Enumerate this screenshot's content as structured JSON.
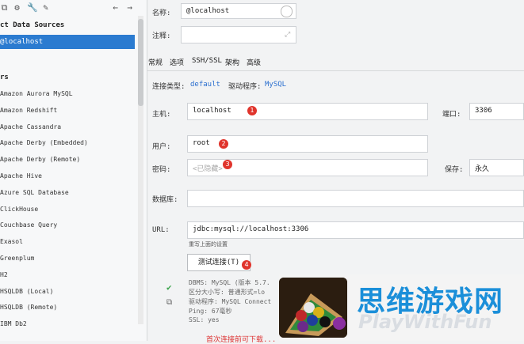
{
  "sidebar": {
    "section_title": "ct Data Sources",
    "selected_source": "@localhost",
    "drivers_title": "rs",
    "drivers": [
      "Amazon Aurora MySQL",
      "Amazon Redshift",
      "Apache Cassandra",
      "Apache Derby (Embedded)",
      "Apache Derby (Remote)",
      "Apache Hive",
      "Azure SQL Database",
      "ClickHouse",
      "Couchbase Query",
      "Exasol",
      "Greenplum",
      "H2",
      "HSQLDB (Local)",
      "HSQLDB (Remote)",
      "IBM Db2"
    ]
  },
  "form": {
    "name_label": "名称:",
    "name_value": "@localhost",
    "comment_label": "注释:",
    "tabs": [
      "常规",
      "选项",
      "SSH/SSL",
      "架构",
      "高级"
    ],
    "conn_type_label": "连接类型:",
    "conn_type_value": "default",
    "driver_label": "驱动程序:",
    "driver_value": "MySQL",
    "host_label": "主机:",
    "host_value": "localhost",
    "port_label": "端口:",
    "port_value": "3306",
    "user_label": "用户:",
    "user_value": "root",
    "password_label": "密码:",
    "password_placeholder": "<已隐藏>",
    "save_label": "保存:",
    "save_value": "永久",
    "database_label": "数据库:",
    "url_label": "URL:",
    "url_value": "jdbc:mysql://localhost:3306",
    "override_hint": "重写上面的设置",
    "test_button": "测试连接(T)",
    "badges": [
      "1",
      "2",
      "3",
      "4"
    ]
  },
  "test_result": {
    "line1": "DBMS: MySQL (版本 5.7.",
    "line2": "区分大小写: 普通形式=lo",
    "line3": "驱动程序: MySQL Connect",
    "line4": "Ping: 67毫秒",
    "line5": "SSL: yes"
  },
  "ad": {
    "title": "思维游戏网",
    "subtitle": "PlayWithFun"
  },
  "bottom_warning": "首次连接前可下载..."
}
